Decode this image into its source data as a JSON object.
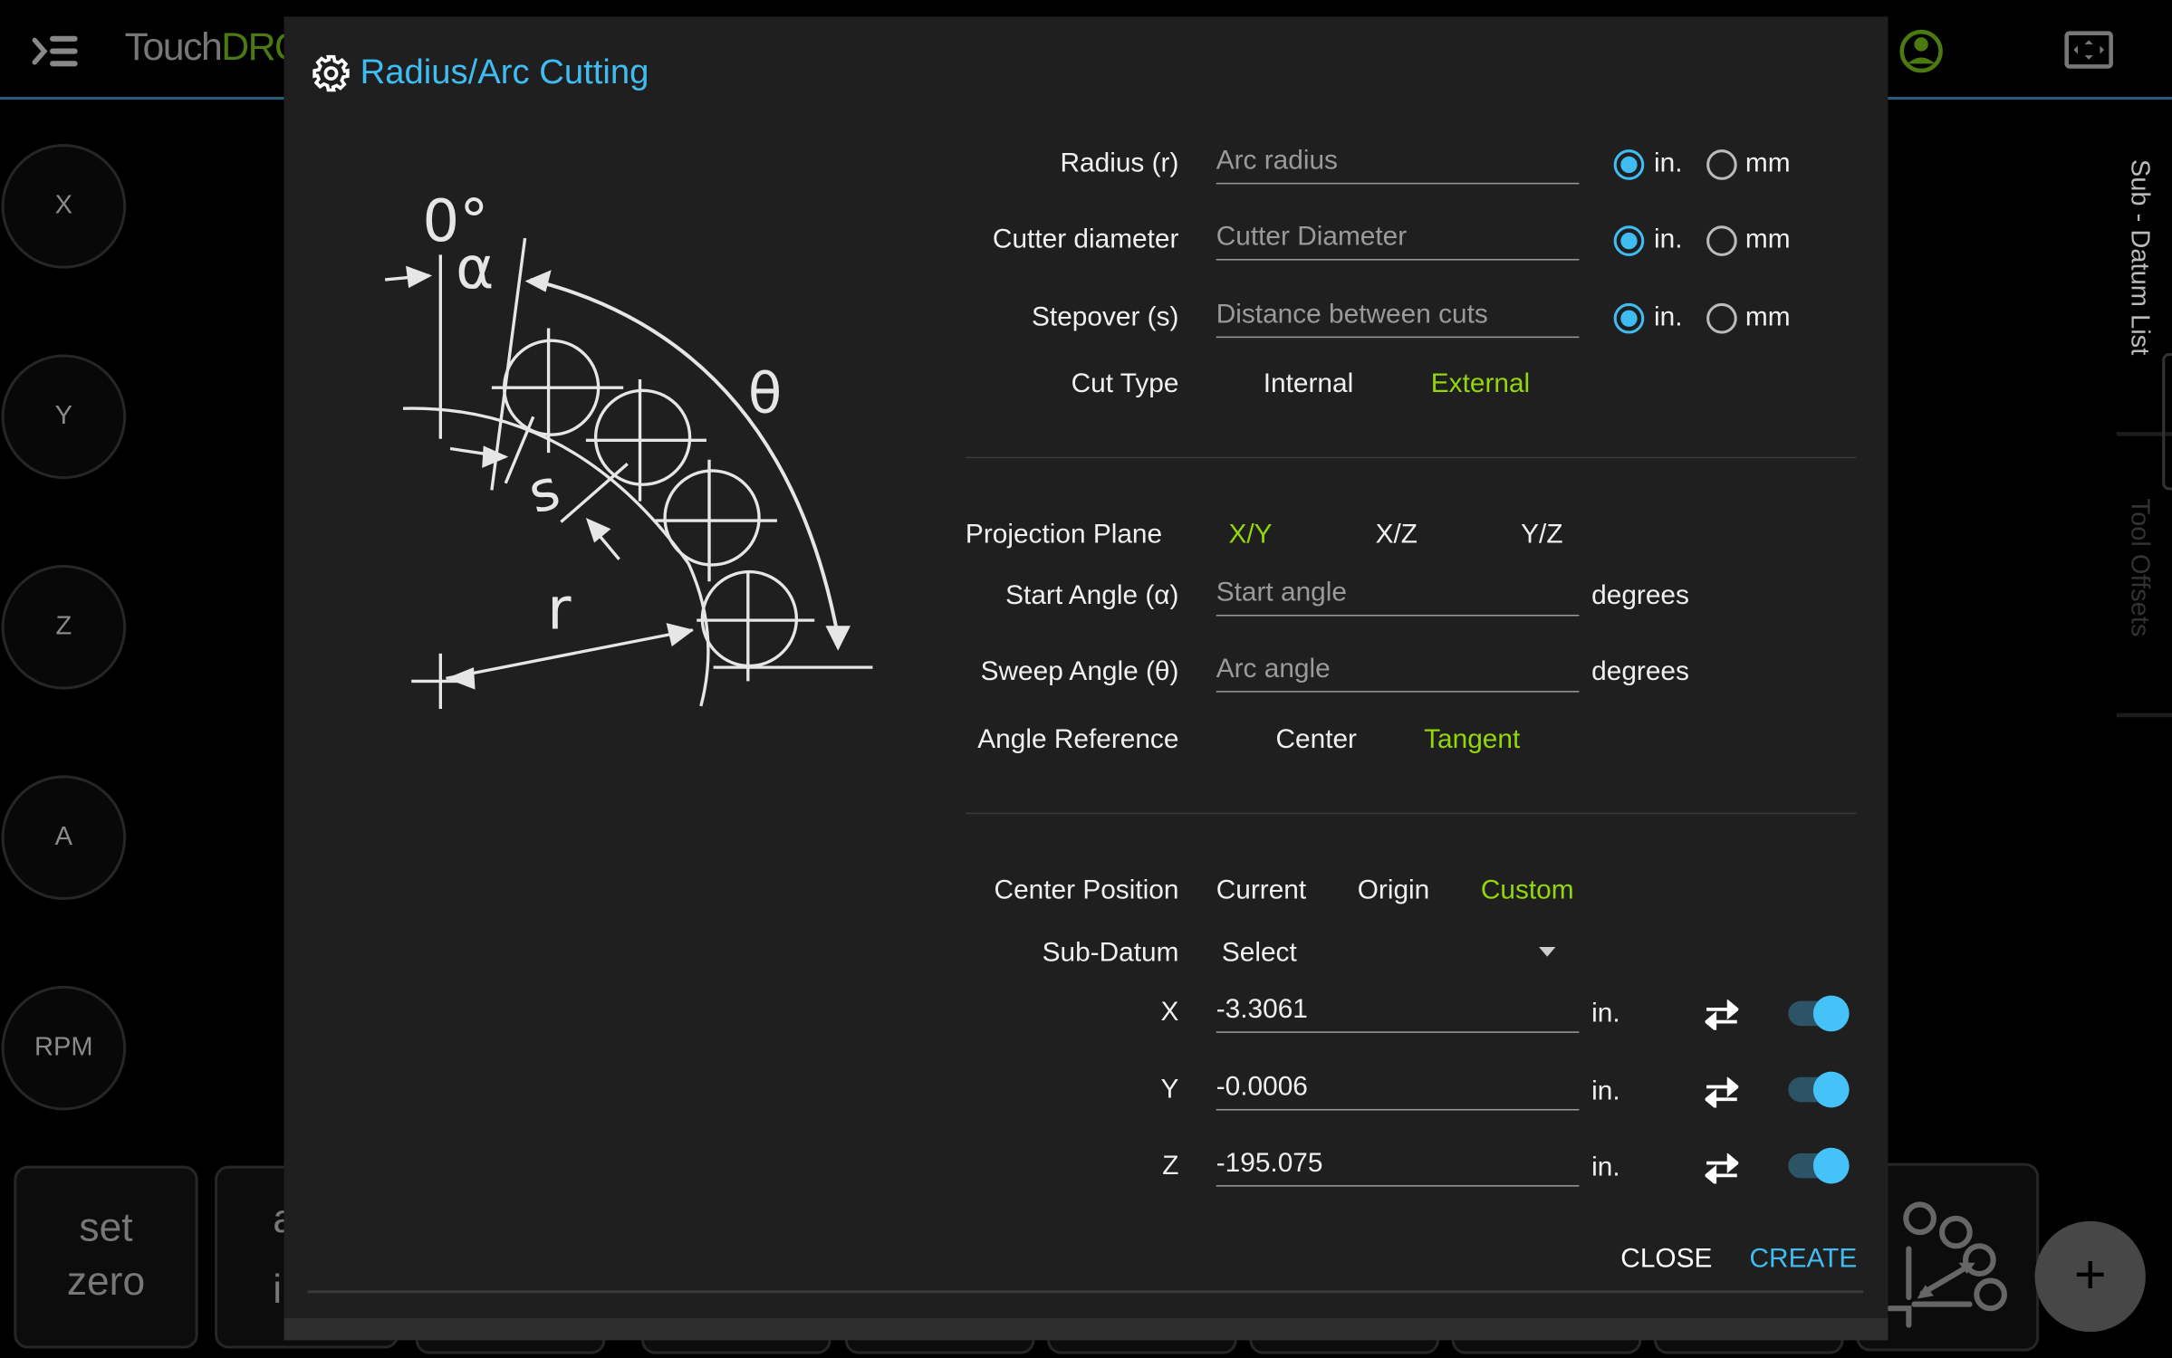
{
  "app": {
    "logo_text_1": "Touch",
    "logo_text_2": "DRO",
    "axes": [
      "X",
      "Y",
      "Z",
      "A",
      "RPM"
    ],
    "bottom_buttons": {
      "set_zero": [
        "set",
        "zero"
      ],
      "partial": [
        "a",
        "i"
      ]
    },
    "side_tabs": [
      "Sub - Datum List",
      "Tool Offsets"
    ],
    "fab_label": "+"
  },
  "dialog": {
    "title": "Radius/Arc Cutting",
    "diagram_labels": {
      "zero": "0°",
      "alpha": "α",
      "theta": "θ",
      "s": "s",
      "r": "r"
    },
    "fields": [
      {
        "label": "Radius (r)",
        "placeholder": "Arc radius",
        "unit_selected": "in.",
        "units": [
          "in.",
          "mm"
        ]
      },
      {
        "label": "Cutter diameter",
        "placeholder": "Cutter Diameter",
        "unit_selected": "in.",
        "units": [
          "in.",
          "mm"
        ]
      },
      {
        "label": "Stepover (s)",
        "placeholder": "Distance between cuts",
        "unit_selected": "in.",
        "units": [
          "in.",
          "mm"
        ]
      }
    ],
    "cut_type": {
      "label": "Cut Type",
      "options": [
        "Internal",
        "External"
      ],
      "selected": "External"
    },
    "projection_plane": {
      "label": "Projection Plane",
      "options": [
        "X/Y",
        "X/Z",
        "Y/Z"
      ],
      "selected": "X/Y"
    },
    "start_angle": {
      "label": "Start Angle (α)",
      "placeholder": "Start angle",
      "unit": "degrees"
    },
    "sweep_angle": {
      "label": "Sweep Angle (θ)",
      "placeholder": "Arc angle",
      "unit": "degrees"
    },
    "angle_reference": {
      "label": "Angle Reference",
      "options": [
        "Center",
        "Tangent"
      ],
      "selected": "Tangent"
    },
    "center_position": {
      "label": "Center Position",
      "options": [
        "Current",
        "Origin",
        "Custom"
      ],
      "selected": "Custom"
    },
    "sub_datum": {
      "label": "Sub-Datum",
      "value": "Select"
    },
    "coords": [
      {
        "axis": "X",
        "value": "-3.3061",
        "unit": "in.",
        "enabled": true
      },
      {
        "axis": "Y",
        "value": "-0.0006",
        "unit": "in.",
        "enabled": true
      },
      {
        "axis": "Z",
        "value": "-195.075",
        "unit": "in.",
        "enabled": true
      }
    ],
    "close_label": "CLOSE",
    "create_label": "CREATE"
  },
  "colors": {
    "accent": "#3fbdf2",
    "selected_option": "#94d60c",
    "dialog_bg": "#1f1f1f"
  }
}
